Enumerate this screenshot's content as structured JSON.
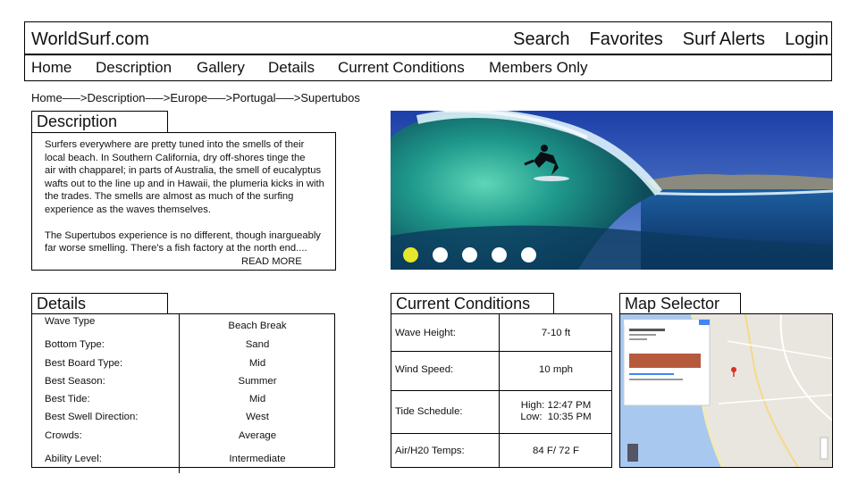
{
  "header": {
    "logo": "WorldSurf.com",
    "links": [
      "Search",
      "Favorites",
      "Surf Alerts",
      "Login"
    ]
  },
  "nav": {
    "items": [
      "Home",
      "Description",
      "Gallery",
      "Details",
      "Current Conditions",
      "Members Only"
    ]
  },
  "breadcrumb": "Home–—>Description–—>Europe–—>Portugal–—>Supertubos",
  "description": {
    "title": "Description",
    "para1_lines": [
      "Surfers everywhere are pretty tuned into the smells of their",
      "local beach.  In Southern California, dry off-shores tinge the",
      "air with chapparel; in parts of Australia, the smell of eucalyptus",
      "wafts out to the line up and in Hawaii, the plumeria kicks in with",
      "the trades.  The smells are almost as much of the surfing",
      "experience as the waves themselves."
    ],
    "para2_lines": [
      "The Supertubos experience is no different, though inargueably",
      "far worse smelling. There's a fish factory at the north end...."
    ],
    "read_more": "READ MORE"
  },
  "slideshow": {
    "slide_count": 5,
    "active_index": 0,
    "active_color": "#e6e62a"
  },
  "details": {
    "title": "Details",
    "rows": [
      {
        "label": "Wave Type",
        "value": "Beach Break"
      },
      {
        "label": "Bottom Type:",
        "value": "Sand"
      },
      {
        "label": "Best Board Type:",
        "value": "Mid"
      },
      {
        "label": "Best Season:",
        "value": "Summer"
      },
      {
        "label": "Best Tide:",
        "value": "Mid"
      },
      {
        "label": "Best Swell Direction:",
        "value": "West"
      },
      {
        "label": "Crowds:",
        "value": "Average"
      },
      {
        "label": "Ability Level:",
        "value": "Intermediate"
      }
    ]
  },
  "conditions": {
    "title": "Current Conditions",
    "rows": [
      {
        "label": "Wave Height:",
        "value": "7-10 ft"
      },
      {
        "label": "Wind Speed:",
        "value": "10 mph"
      },
      {
        "label": "Tide Schedule:",
        "value": "High: 12:47 PM\nLow:  10:35 PM"
      },
      {
        "label": "Air/H20 Temps:",
        "value": "84 F/ 72 F"
      }
    ]
  },
  "map": {
    "title": "Map Selector"
  }
}
